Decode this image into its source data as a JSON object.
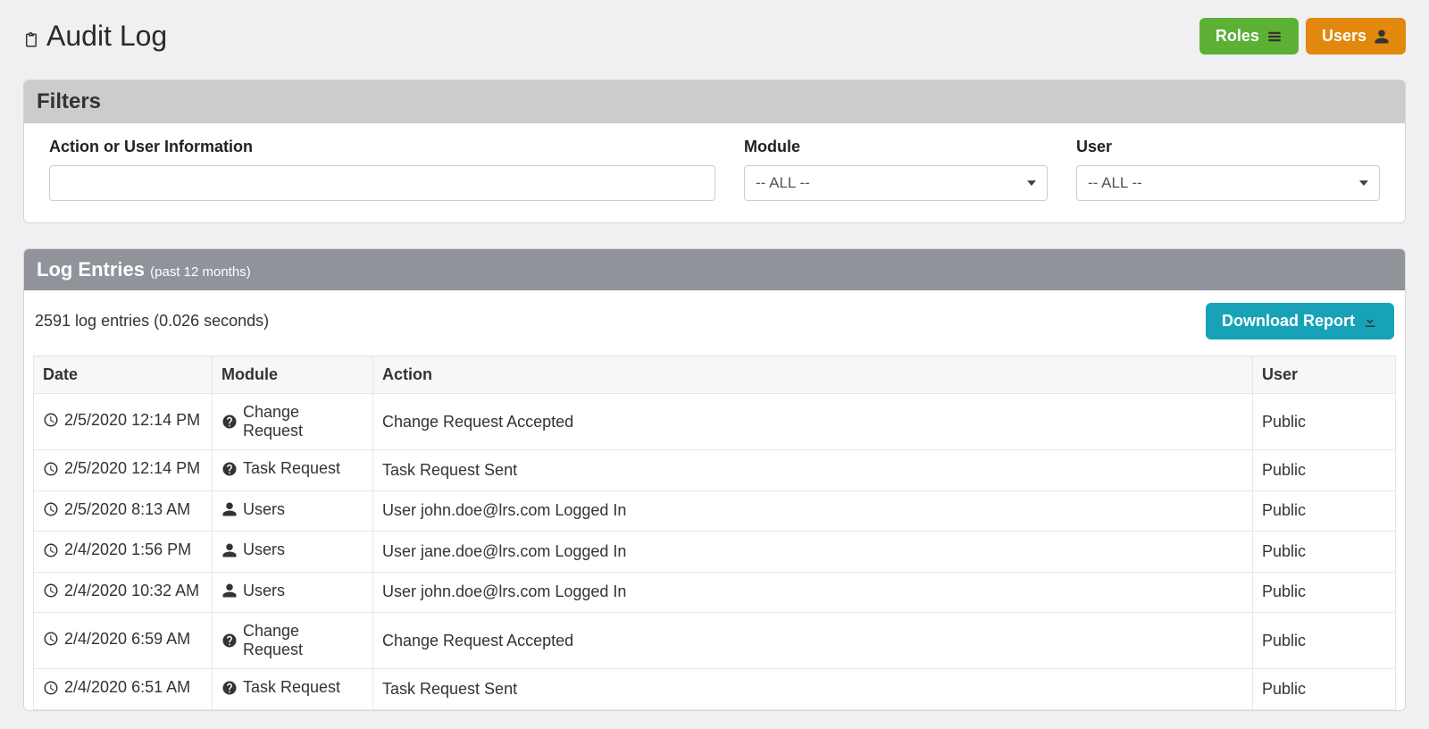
{
  "header": {
    "title": "Audit Log",
    "roles_button": "Roles",
    "users_button": "Users"
  },
  "filters": {
    "panel_title": "Filters",
    "search_label": "Action or User Information",
    "search_value": "",
    "module_label": "Module",
    "module_selected": "-- ALL --",
    "user_label": "User",
    "user_selected": "-- ALL --"
  },
  "log": {
    "panel_title": "Log Entries",
    "panel_sub": "(past 12 months)",
    "summary": "2591 log entries (0.026 seconds)",
    "download_label": "Download Report",
    "columns": {
      "date": "Date",
      "module": "Module",
      "action": "Action",
      "user": "User"
    },
    "rows": [
      {
        "date": "2/5/2020 12:14 PM",
        "module_icon": "question",
        "module": "Change Request",
        "action": "Change Request Accepted",
        "user": "Public"
      },
      {
        "date": "2/5/2020 12:14 PM",
        "module_icon": "question",
        "module": "Task Request",
        "action": "Task Request Sent",
        "user": "Public"
      },
      {
        "date": "2/5/2020 8:13 AM",
        "module_icon": "user",
        "module": "Users",
        "action": "User john.doe@lrs.com Logged In",
        "user": "Public"
      },
      {
        "date": "2/4/2020 1:56 PM",
        "module_icon": "user",
        "module": "Users",
        "action": "User jane.doe@lrs.com Logged In",
        "user": "Public"
      },
      {
        "date": "2/4/2020 10:32 AM",
        "module_icon": "user",
        "module": "Users",
        "action": "User john.doe@lrs.com Logged In",
        "user": "Public"
      },
      {
        "date": "2/4/2020 6:59 AM",
        "module_icon": "question",
        "module": "Change Request",
        "action": "Change Request Accepted",
        "user": "Public"
      },
      {
        "date": "2/4/2020 6:51 AM",
        "module_icon": "question",
        "module": "Task Request",
        "action": "Task Request Sent",
        "user": "Public"
      }
    ]
  }
}
